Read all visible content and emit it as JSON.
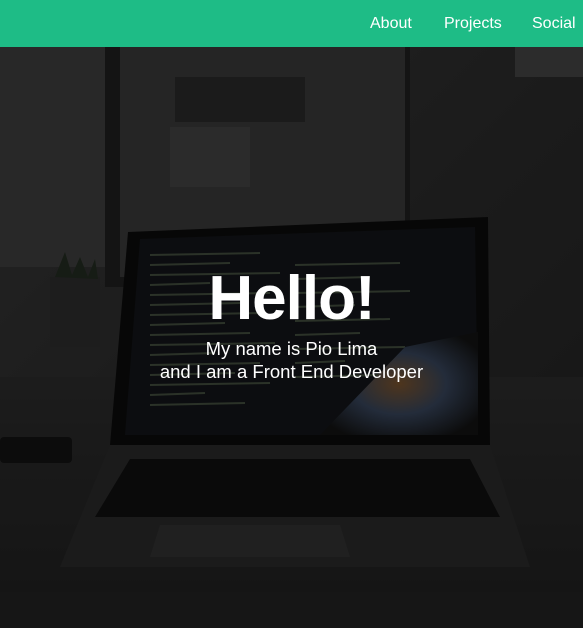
{
  "nav": {
    "items": [
      {
        "label": "About"
      },
      {
        "label": "Projects"
      },
      {
        "label": "Social"
      }
    ]
  },
  "hero": {
    "title": "Hello!",
    "subtitle_line1": "My name is Pio Lima",
    "subtitle_line2": "and I am a Front End Developer"
  },
  "colors": {
    "navbar": "#1ebc86",
    "text": "#ffffff",
    "overlay": "rgba(0,0,0,0.52)"
  }
}
